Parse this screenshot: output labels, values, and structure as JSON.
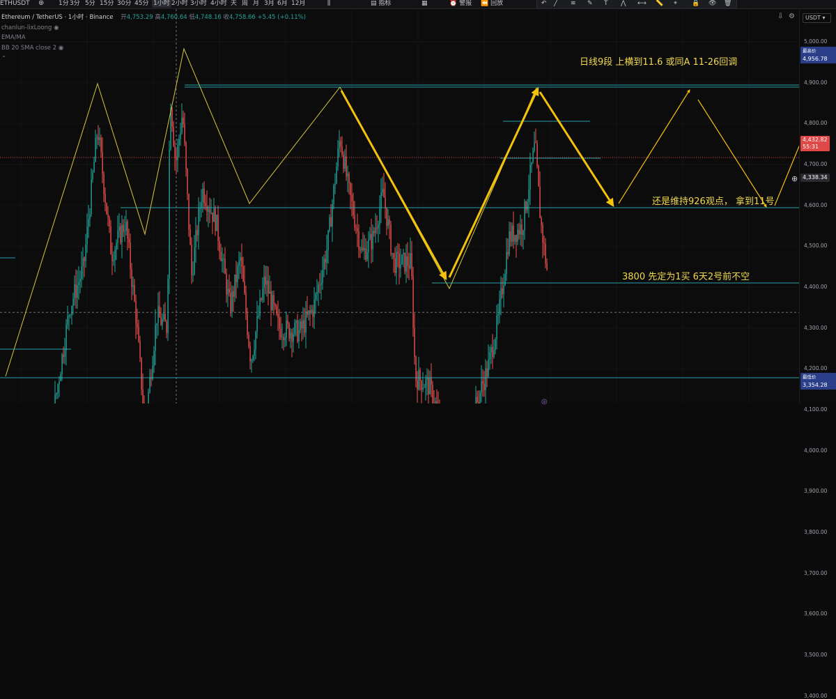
{
  "toolbar": {
    "symbol": "ETHUSDT",
    "intervals": [
      "1分",
      "3分",
      "5分",
      "15分",
      "30分",
      "45分",
      "1小时",
      "2小时",
      "3小时",
      "4小时",
      "天",
      "周",
      "月",
      "3月",
      "6月",
      "12月"
    ],
    "active_interval": "1小时",
    "indicators_label": "指标",
    "alert_label": "警报",
    "replay_label": "回放"
  },
  "legend": {
    "title": "Ethereum / TetherUS · 1小时 · Binance",
    "open_label": "开",
    "open": "4,753.29",
    "high_label": "高",
    "high": "4,760.64",
    "low_label": "低",
    "low": "4,748.16",
    "close_label": "收",
    "close": "4,758.66",
    "change": "+5.45 (+0.11%)",
    "indicator1": "chanlun-lixLoong",
    "indicator2": "EMA/MA",
    "indicator3": "BB 20 SMA close 2"
  },
  "price_axis": {
    "currency": "USDT",
    "ticks": [
      "5,000.00",
      "4,900.00",
      "4,800.00",
      "4,700.00",
      "4,600.00",
      "4,500.00",
      "4,400.00",
      "4,300.00",
      "4,200.00",
      "4,100.00",
      "4,000.00",
      "3,900.00",
      "3,800.00",
      "3,700.00",
      "3,600.00",
      "3,500.00",
      "3,400.00"
    ],
    "high_label": "最高价",
    "high_value": "4,956.78",
    "current_price": "4,432.82",
    "countdown": "55:31",
    "crosshair_price": "4,338.34",
    "low_label": "最低价",
    "low_value": "3,354.28"
  },
  "annotations": {
    "line1": "日线9段    上横到11.6    或同A         11-26回调",
    "line2": "还是维持926观点，   拿到11号",
    "line3": "3800   先定为1买       6天2号前不空"
  },
  "colors": {
    "up": "#26a69a",
    "down": "#ef5350",
    "annotation": "#f5c20b",
    "zigzag": "#d8c836",
    "level": "#2fb8c6"
  }
}
